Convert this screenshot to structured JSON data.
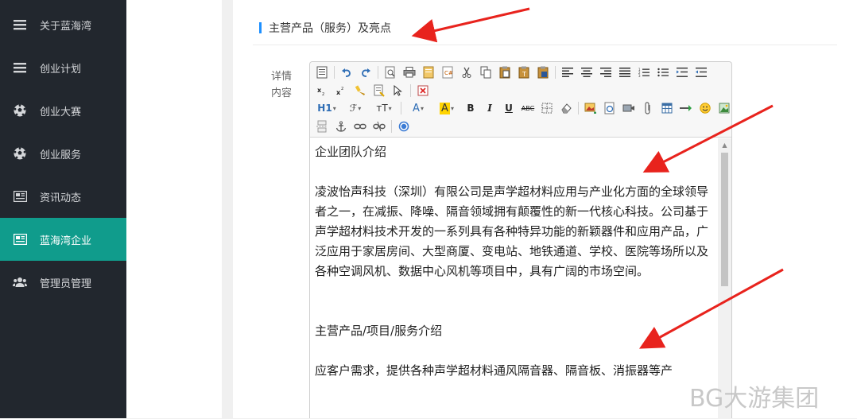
{
  "sidebar": {
    "items": [
      {
        "label": "关于蓝海湾",
        "icon": "menu-icon",
        "active": false
      },
      {
        "label": "创业计划",
        "icon": "menu-icon",
        "active": false
      },
      {
        "label": "创业大赛",
        "icon": "soccer-ball-icon",
        "active": false
      },
      {
        "label": "创业服务",
        "icon": "soccer-ball-icon",
        "active": false
      },
      {
        "label": "资讯动态",
        "icon": "newspaper-icon",
        "active": false
      },
      {
        "label": "蓝海湾企业",
        "icon": "newspaper-icon",
        "active": true
      },
      {
        "label": "管理员管理",
        "icon": "users-icon",
        "active": false
      }
    ]
  },
  "section": {
    "title": "主营产品（服务）及亮点"
  },
  "field": {
    "label_line1": "详情",
    "label_line2": "内容"
  },
  "toolbar": {
    "heading_label": "H1",
    "font_family_label": "ℱ",
    "font_size_label": "ᴛT",
    "font_color_label": "A",
    "bg_color_label": "A",
    "bold_label": "B",
    "italic_label": "I",
    "underline_label": "U",
    "strike_label": "ABC"
  },
  "editor": {
    "paragraphs": [
      "企业团队介绍",
      "",
      "凌波怡声科技（深圳）有限公司是声学超材料应用与产业化方面的全球领导者之一，在减振、降噪、隔音领域拥有颠覆性的新一代核心科技。公司基于声学超材料技术开发的一系列具有各种特异功能的新颖器件和应用产品，广泛应用于家居房间、大型商厦、变电站、地铁通道、学校、医院等场所以及各种空调风机、数据中心风机等项目中，具有广阔的市场空间。",
      "",
      "",
      "主营产品/项目/服务介绍",
      "",
      "应客户需求，提供各种声学超材料通风隔音器、隔音板、消振器等产"
    ]
  },
  "watermark": {
    "text": "BG大游集团"
  },
  "colors": {
    "sidebar_bg": "#22272e",
    "active_item_bg": "#109c8c",
    "section_accent": "#1e90ff",
    "arrow": "#e8231d"
  }
}
